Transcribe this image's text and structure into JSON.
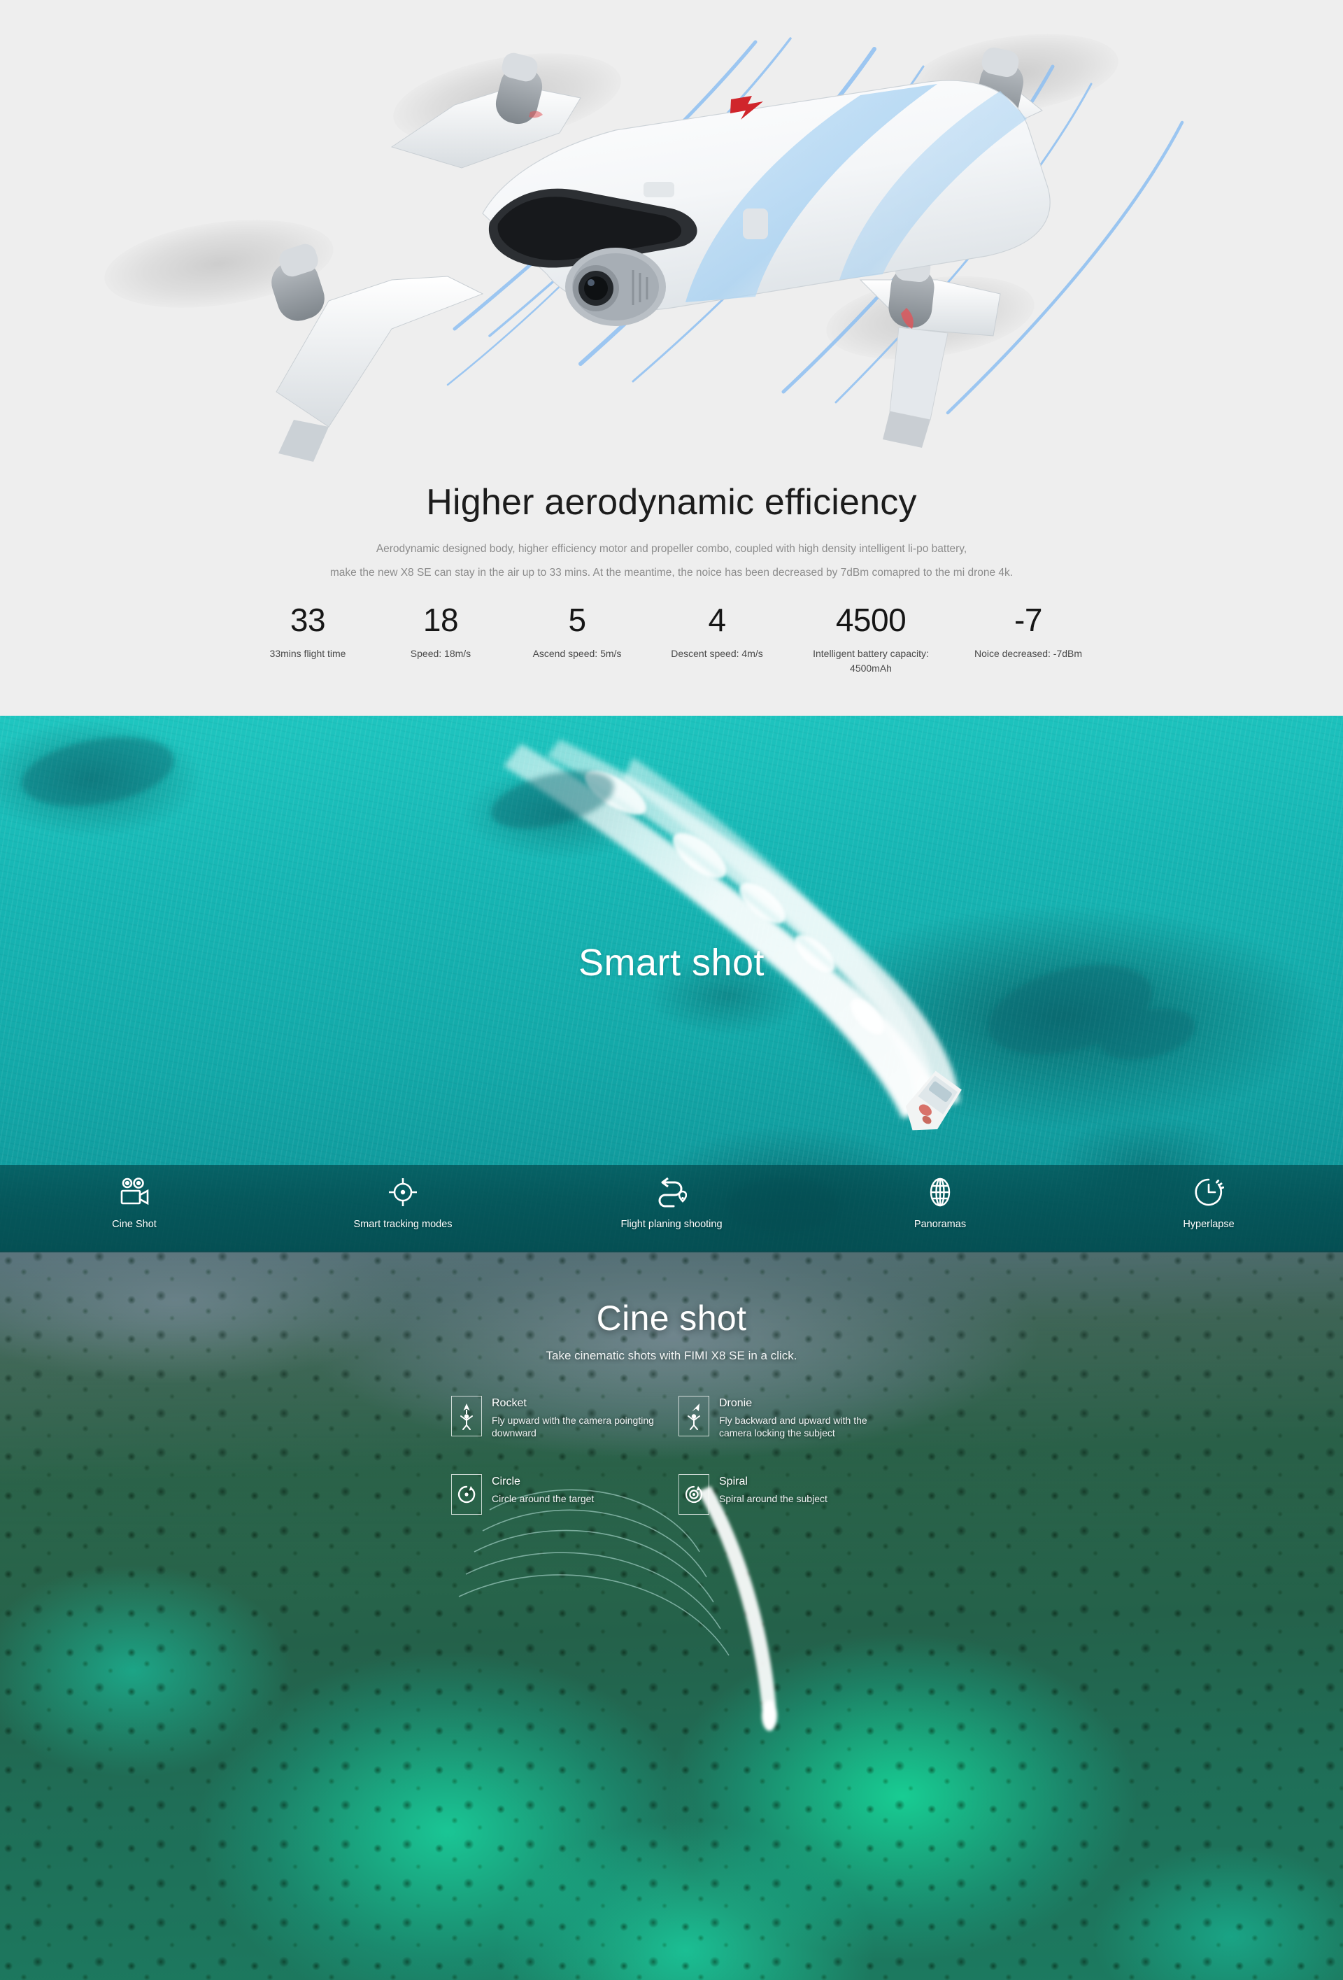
{
  "hero": {
    "title": "Higher aerodynamic efficiency",
    "subtitle_line1": "Aerodynamic designed body, higher efficiency motor and propeller combo, coupled with high density intelligent li-po battery,",
    "subtitle_line2": "make the new X8 SE can stay in the air up to 33 mins. At the meantime, the noice has been decreased by 7dBm comapred to the mi drone 4k.",
    "product_image_alt": "fimi-x8-se-drone-white-quadcopter",
    "background_color": "#eeeeee",
    "stats": [
      {
        "value": "33",
        "label": "33mins flight time"
      },
      {
        "value": "18",
        "label": "Speed: 18m/s"
      },
      {
        "value": "5",
        "label": "Ascend speed: 5m/s"
      },
      {
        "value": "4",
        "label": "Descent speed: 4m/s"
      },
      {
        "value": "4500",
        "label": "Intelligent battery capacity: 4500mAh"
      },
      {
        "value": "-7",
        "label": "Noice decreased: -7dBm"
      }
    ]
  },
  "smart_shot": {
    "title": "Smart shot",
    "background_image_alt": "aerial-turquoise-ocean-speedboat-wake",
    "water_color": "#17b6b4",
    "band_color": "#034a4e",
    "modes": [
      {
        "label": "Cine Shot",
        "icon": "movie-camera-icon"
      },
      {
        "label": "Smart tracking modes",
        "icon": "crosshair-target-icon"
      },
      {
        "label": "Flight planing shooting",
        "icon": "route-waypoint-icon"
      },
      {
        "label": "Panoramas",
        "icon": "globe-icon"
      },
      {
        "label": "Hyperlapse",
        "icon": "clock-timelapse-icon"
      }
    ]
  },
  "cine_shot": {
    "title": "Cine shot",
    "subtitle": "Take cinematic shots with FIMI X8 SE in a click.",
    "background_image_alt": "aerial-mangrove-islands-green-lagoon-boat",
    "modes": [
      {
        "name": "Rocket",
        "desc": "Fly upward with the camera poingting downward",
        "icon": "rocket-person-up-arrow-icon"
      },
      {
        "name": "Dronie",
        "desc": "Fly backward and upward with the camera locking the subject",
        "icon": "dronie-person-diagonal-arrow-icon"
      },
      {
        "name": "Circle",
        "desc": "Circle around the target",
        "icon": "circle-orbit-icon"
      },
      {
        "name": "Spiral",
        "desc": "Spiral around the subject",
        "icon": "spiral-orbit-icon"
      }
    ]
  }
}
